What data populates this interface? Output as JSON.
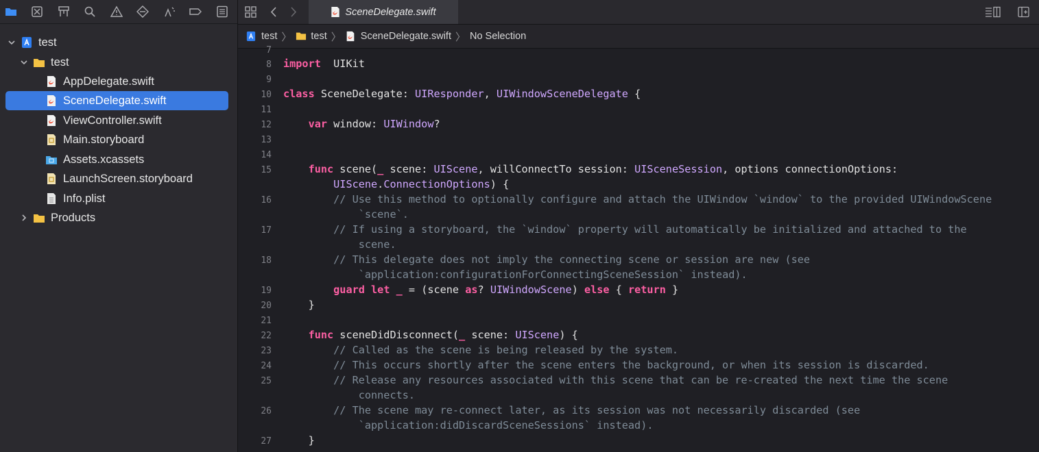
{
  "navigator": {
    "icons": [
      "folder-icon",
      "source-control-icon",
      "hierarchy-icon",
      "search-icon",
      "warning-icon",
      "test-diamond-icon",
      "debug-icon",
      "breakpoint-icon",
      "report-icon"
    ],
    "tree": [
      {
        "label": "test",
        "kind": "project",
        "disclosure": "open",
        "depth": 0
      },
      {
        "label": "test",
        "kind": "folder",
        "disclosure": "open",
        "depth": 1
      },
      {
        "label": "AppDelegate.swift",
        "kind": "swift",
        "depth": 2
      },
      {
        "label": "SceneDelegate.swift",
        "kind": "swift",
        "depth": 2,
        "selected": true
      },
      {
        "label": "ViewController.swift",
        "kind": "swift",
        "depth": 2
      },
      {
        "label": "Main.storyboard",
        "kind": "storyboard",
        "depth": 2
      },
      {
        "label": "Assets.xcassets",
        "kind": "assets",
        "depth": 2
      },
      {
        "label": "LaunchScreen.storyboard",
        "kind": "storyboard",
        "depth": 2
      },
      {
        "label": "Info.plist",
        "kind": "plist",
        "depth": 2
      },
      {
        "label": "Products",
        "kind": "folder",
        "disclosure": "closed",
        "depth": 1
      }
    ]
  },
  "tabbar": {
    "active_tab": "SceneDelegate.swift"
  },
  "jumpbar": {
    "items": [
      "test",
      "test",
      "SceneDelegate.swift",
      "No Selection"
    ]
  },
  "code": {
    "top_stub": "7",
    "lines": [
      {
        "n": "8",
        "segs": [
          [
            "kw",
            "import"
          ],
          [
            "",
            "  UIKit"
          ]
        ]
      },
      {
        "n": "9",
        "segs": []
      },
      {
        "n": "10",
        "segs": [
          [
            "kw",
            "class"
          ],
          [
            "",
            " SceneDelegate: "
          ],
          [
            "ty",
            "UIResponder"
          ],
          [
            "",
            ", "
          ],
          [
            "ty",
            "UIWindowSceneDelegate"
          ],
          [
            "",
            " {"
          ]
        ]
      },
      {
        "n": "11",
        "segs": []
      },
      {
        "n": "12",
        "segs": [
          [
            "",
            "    "
          ],
          [
            "kw",
            "var"
          ],
          [
            "",
            " window: "
          ],
          [
            "ty",
            "UIWindow"
          ],
          [
            "",
            "?"
          ]
        ]
      },
      {
        "n": "13",
        "segs": []
      },
      {
        "n": "14",
        "segs": []
      },
      {
        "n": "15",
        "segs": [
          [
            "",
            "    "
          ],
          [
            "kw",
            "func"
          ],
          [
            "",
            " scene("
          ],
          [
            "kw",
            "_"
          ],
          [
            "",
            " scene: "
          ],
          [
            "ty",
            "UIScene"
          ],
          [
            "",
            ", willConnectTo session: "
          ],
          [
            "ty",
            "UISceneSession"
          ],
          [
            "",
            ", options connectionOptions:"
          ]
        ]
      },
      {
        "n": "",
        "segs": [
          [
            "",
            "        "
          ],
          [
            "ty",
            "UIScene"
          ],
          [
            "",
            "."
          ],
          [
            "ty",
            "ConnectionOptions"
          ],
          [
            "",
            ") {"
          ]
        ]
      },
      {
        "n": "16",
        "segs": [
          [
            "",
            "        "
          ],
          [
            "cm",
            "// Use this method to optionally configure and attach the UIWindow `window` to the provided UIWindowScene"
          ]
        ]
      },
      {
        "n": "",
        "segs": [
          [
            "",
            "            "
          ],
          [
            "cm",
            "`scene`."
          ]
        ]
      },
      {
        "n": "17",
        "segs": [
          [
            "",
            "        "
          ],
          [
            "cm",
            "// If using a storyboard, the `window` property will automatically be initialized and attached to the"
          ]
        ]
      },
      {
        "n": "",
        "segs": [
          [
            "",
            "            "
          ],
          [
            "cm",
            "scene."
          ]
        ]
      },
      {
        "n": "18",
        "segs": [
          [
            "",
            "        "
          ],
          [
            "cm",
            "// This delegate does not imply the connecting scene or session are new (see"
          ]
        ]
      },
      {
        "n": "",
        "segs": [
          [
            "",
            "            "
          ],
          [
            "cm",
            "`application:configurationForConnectingSceneSession` instead)."
          ]
        ]
      },
      {
        "n": "19",
        "segs": [
          [
            "",
            "        "
          ],
          [
            "kw",
            "guard"
          ],
          [
            "",
            " "
          ],
          [
            "kw",
            "let"
          ],
          [
            "",
            " "
          ],
          [
            "kw",
            "_"
          ],
          [
            "",
            " = (scene "
          ],
          [
            "kw",
            "as"
          ],
          [
            "",
            "? "
          ],
          [
            "ty",
            "UIWindowScene"
          ],
          [
            "",
            ") "
          ],
          [
            "kw",
            "else"
          ],
          [
            "",
            " { "
          ],
          [
            "kw",
            "return"
          ],
          [
            "",
            " }"
          ]
        ]
      },
      {
        "n": "20",
        "segs": [
          [
            "",
            "    }"
          ]
        ]
      },
      {
        "n": "21",
        "segs": []
      },
      {
        "n": "22",
        "segs": [
          [
            "",
            "    "
          ],
          [
            "kw",
            "func"
          ],
          [
            "",
            " sceneDidDisconnect("
          ],
          [
            "kw",
            "_"
          ],
          [
            "",
            " scene: "
          ],
          [
            "ty",
            "UIScene"
          ],
          [
            "",
            ") {"
          ]
        ]
      },
      {
        "n": "23",
        "segs": [
          [
            "",
            "        "
          ],
          [
            "cm",
            "// Called as the scene is being released by the system."
          ]
        ]
      },
      {
        "n": "24",
        "segs": [
          [
            "",
            "        "
          ],
          [
            "cm",
            "// This occurs shortly after the scene enters the background, or when its session is discarded."
          ]
        ]
      },
      {
        "n": "25",
        "segs": [
          [
            "",
            "        "
          ],
          [
            "cm",
            "// Release any resources associated with this scene that can be re-created the next time the scene"
          ]
        ]
      },
      {
        "n": "",
        "segs": [
          [
            "",
            "            "
          ],
          [
            "cm",
            "connects."
          ]
        ]
      },
      {
        "n": "26",
        "segs": [
          [
            "",
            "        "
          ],
          [
            "cm",
            "// The scene may re-connect later, as its session was not necessarily discarded (see"
          ]
        ]
      },
      {
        "n": "",
        "segs": [
          [
            "",
            "            "
          ],
          [
            "cm",
            "`application:didDiscardSceneSessions` instead)."
          ]
        ]
      },
      {
        "n": "27",
        "segs": [
          [
            "",
            "    }"
          ]
        ]
      }
    ]
  }
}
